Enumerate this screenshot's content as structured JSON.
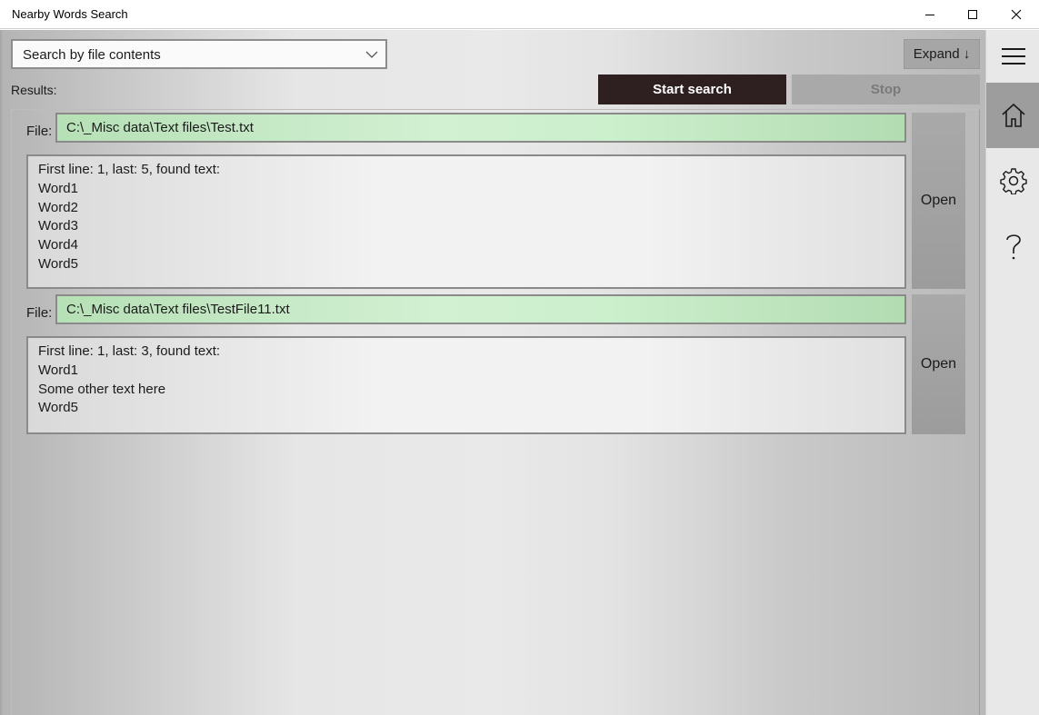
{
  "window": {
    "title": "Nearby Words Search",
    "controls": [
      "minimize-icon",
      "maximize-icon",
      "close-icon"
    ]
  },
  "toolbar": {
    "search_mode": "Search by file contents",
    "expand_label": "Expand ↓",
    "results_label": "Results:",
    "start_label": "Start search",
    "stop_label": "Stop"
  },
  "file_label": "File:",
  "results": [
    {
      "path": "C:\\_Misc data\\Text files\\Test.txt",
      "lines": [
        "First line: 1, last: 5, found text:",
        "Word1",
        "Word2",
        "Word3",
        "Word4",
        "Word5"
      ],
      "open_label": "Open"
    },
    {
      "path": "C:\\_Misc data\\Text files\\TestFile11.txt",
      "lines": [
        "First line: 1, last: 3, found text:",
        "Word1",
        "Some other text here",
        "Word5"
      ],
      "open_label": "Open"
    }
  ],
  "nav": {
    "items": [
      "hamburger-menu-icon",
      "home-icon",
      "gear-icon",
      "help-icon"
    ],
    "active": "home-icon"
  },
  "colors": {
    "start_button": "#2e1f21",
    "file_path_bg": "#d2f0d2",
    "nav_active": "#9d9d9d"
  }
}
